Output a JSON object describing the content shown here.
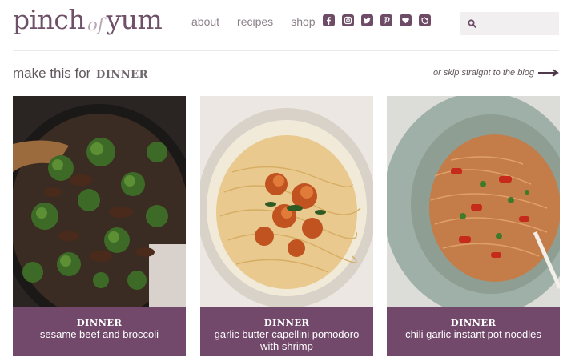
{
  "header": {
    "logo": {
      "part1": "pinch",
      "part2": "of",
      "part3": "yum"
    },
    "nav": [
      {
        "label": "about"
      },
      {
        "label": "recipes"
      },
      {
        "label": "shop"
      }
    ],
    "social": [
      {
        "icon": "facebook-icon"
      },
      {
        "icon": "instagram-icon"
      },
      {
        "icon": "twitter-icon"
      },
      {
        "icon": "pinterest-icon"
      },
      {
        "icon": "bloglovin-heart-icon"
      },
      {
        "icon": "yummly-icon"
      }
    ],
    "search": {
      "placeholder": "",
      "icon": "search-icon"
    }
  },
  "section": {
    "prefix": "make this for",
    "category": "DINNER",
    "skip_link": "or skip straight to the blog"
  },
  "cards": [
    {
      "category": "DINNER",
      "title": "sesame beef and broccoli"
    },
    {
      "category": "DINNER",
      "title": "garlic butter capellini pomodoro with shrimp"
    },
    {
      "category": "DINNER",
      "title": "chili garlic instant pot noodles"
    }
  ],
  "colors": {
    "brand_purple": "#72496b",
    "logo": "#6e5068",
    "nav_text": "#8a8088",
    "search_bg": "#f1eff0"
  }
}
